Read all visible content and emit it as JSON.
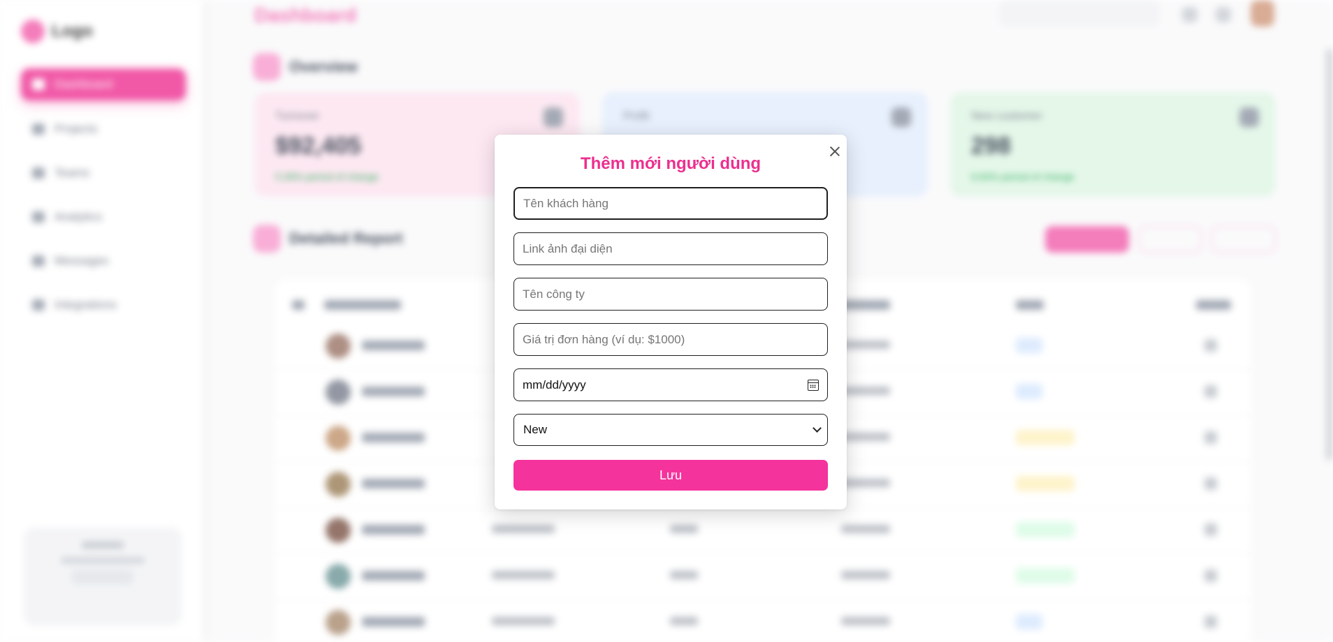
{
  "background": {
    "logo_text": "Logo",
    "main_title": "Dashboard",
    "nav_items": [
      "Dashboard",
      "Projects",
      "Teams",
      "Analytics",
      "Messages",
      "Integrations"
    ],
    "section_overview": "Overview",
    "section_report": "Detailed Report",
    "cards": [
      {
        "label": "Turnover",
        "value": "$92,405",
        "note": "5.39% period of change",
        "color": "#fde7f1"
      },
      {
        "label": "Profit",
        "value": "",
        "note": "",
        "color": "#e6effd"
      },
      {
        "label": "New customer",
        "value": "298",
        "note": "6.84% period of change",
        "color": "#e3f7e8"
      }
    ],
    "buttons": [
      "Add user",
      "Import",
      "Export"
    ]
  },
  "modal": {
    "title": "Thêm mới người dùng",
    "fields": {
      "customer_name_placeholder": "Tên khách hàng",
      "avatar_link_placeholder": "Link ảnh đại diện",
      "company_placeholder": "Tên công ty",
      "order_value_placeholder": "Giá trị đơn hàng (ví dụ: $1000)",
      "date_value": "mm/dd/yyyy",
      "status_value": "New"
    },
    "save_label": "Lưu",
    "accent_color": "#ec2f8f"
  }
}
